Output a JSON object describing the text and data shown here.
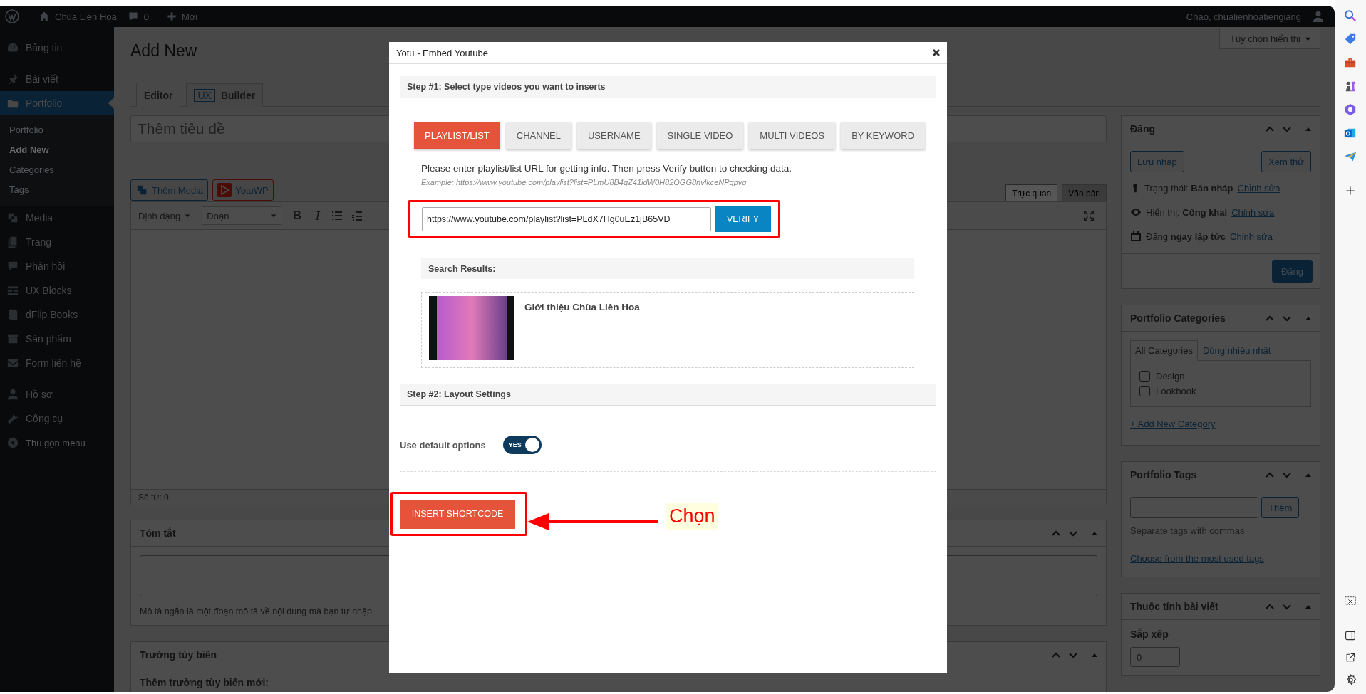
{
  "admin_bar": {
    "site_name": "Chùa Liên Hoa",
    "comments": "0",
    "new": "Mới",
    "greeting": "Chào, chualienhoatiengiang"
  },
  "admin_menu": {
    "sections": [
      [
        {
          "label": "Bảng tin",
          "selected": false,
          "kind": "item"
        }
      ],
      [
        {
          "label": "Bài viết",
          "selected": false,
          "kind": "item"
        },
        {
          "label": "Portfolio",
          "selected": true,
          "kind": "item",
          "children": [
            {
              "label": "Portfolio",
              "selected": false
            },
            {
              "label": "Add New",
              "selected": true
            },
            {
              "label": "Categories",
              "selected": false
            },
            {
              "label": "Tags",
              "selected": false
            }
          ]
        },
        {
          "label": "Media",
          "selected": false,
          "kind": "item"
        },
        {
          "label": "Trang",
          "selected": false,
          "kind": "item"
        },
        {
          "label": "Phản hồi",
          "selected": false,
          "kind": "item"
        },
        {
          "label": "UX Blocks",
          "selected": false,
          "kind": "item"
        },
        {
          "label": "dFlip Books",
          "selected": false,
          "kind": "item"
        },
        {
          "label": "Sản phẩm",
          "selected": false,
          "kind": "item"
        },
        {
          "label": "Form liên hệ",
          "selected": false,
          "kind": "item"
        }
      ],
      [
        {
          "label": "Hồ sơ",
          "selected": false,
          "kind": "item"
        },
        {
          "label": "Công cụ",
          "selected": false,
          "kind": "item"
        },
        {
          "label": "Thu gọn menu",
          "selected": false,
          "kind": "collapse"
        }
      ]
    ]
  },
  "page": {
    "title": "Add New",
    "screen_options": "Tùy chọn hiển thị",
    "tabs": [
      {
        "label": "Editor",
        "selected": true
      },
      {
        "badge": "UX",
        "label": "Builder",
        "selected": false
      }
    ]
  },
  "editor": {
    "title_placeholder": "Thêm tiêu đề",
    "media_buttons": [
      {
        "label": "Thêm Media",
        "kind": "media"
      },
      {
        "label": "YotuWP",
        "kind": "yotu"
      }
    ],
    "modes": [
      {
        "label": "Trực quan",
        "selected": true
      },
      {
        "label": "Văn bản",
        "selected": false
      }
    ],
    "format_select": "Định dạng",
    "paragraph_select": "Đoạn",
    "toolbar": [
      "B",
      "I"
    ],
    "word_count": "Số từ: 0"
  },
  "excerpt": {
    "title": "Tóm tắt",
    "description": "Mô tả ngắn là một đoạn mô tả về nội dung mà bạn tự nhập"
  },
  "custom_fields": {
    "title": "Trường tùy biến",
    "add_label": "Thêm trường tùy biến mới:"
  },
  "publish": {
    "title": "Đăng",
    "save_draft": "Lưu nháp",
    "preview": "Xem thử",
    "rows": [
      {
        "text": "Trạng thái: **Bản nháp**",
        "link": "Chỉnh sửa"
      },
      {
        "text": "Hiển thị: **Công khai**",
        "link": "Chỉnh sửa"
      },
      {
        "text": "Đăng **ngay lập tức**",
        "link": "Chỉnh sửa"
      }
    ],
    "publish_button": "Đăng"
  },
  "categories": {
    "title": "Portfolio Categories",
    "tabs": [
      {
        "label": "All Categories",
        "selected": true
      },
      {
        "label": "Dùng nhiều nhất",
        "selected": false
      }
    ],
    "items": [
      {
        "label": "Design",
        "checked": false
      },
      {
        "label": "Lookbook",
        "checked": false
      }
    ],
    "add_link": "+ Add New Category"
  },
  "tags": {
    "title": "Portfolio Tags",
    "add_button": "Thêm",
    "hint": "Separate tags with commas",
    "link": "Choose from the most used tags"
  },
  "attributes": {
    "title": "Thuộc tính bài viết",
    "order_label": "Sắp xếp",
    "order_value": "0"
  },
  "modal": {
    "title": "Yotu - Embed Youtube",
    "step1": "Step #1: Select type videos you want to inserts",
    "types": [
      {
        "label": "PLAYLIST/LIST",
        "selected": true
      },
      {
        "label": "CHANNEL",
        "selected": false
      },
      {
        "label": "USERNAME",
        "selected": false
      },
      {
        "label": "SINGLE VIDEO",
        "selected": false
      },
      {
        "label": "MULTI VIDEOS",
        "selected": false
      },
      {
        "label": "BY KEYWORD",
        "selected": false
      }
    ],
    "instruction": "Please enter playlist/list URL for getting info. Then press Verify button to checking data.",
    "example": "Example: https://www.youtube.com/playlist?list=PLmU8B4gZ41idW0H82OGG8nvlkceNPqpvq",
    "url_value": "https://www.youtube.com/playlist?list=PLdX7Hg0uEz1jB65VD",
    "verify": "VERIFY",
    "results_title": "Search Results:",
    "results": [
      {
        "title": "Giới thiệu Chùa Liên Hoa"
      }
    ],
    "step2": "Step #2: Layout Settings",
    "default_options": {
      "label": "Use default options",
      "on": true,
      "on_text": "YES"
    },
    "insert": "INSERT SHORTCODE"
  },
  "annotation": {
    "label": "Chọn"
  }
}
